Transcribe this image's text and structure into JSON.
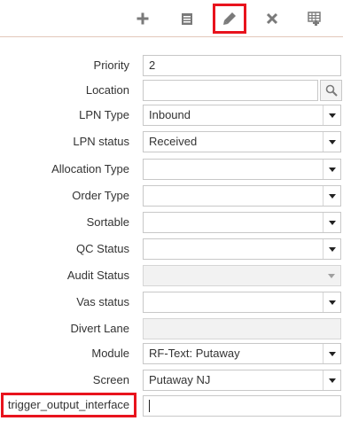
{
  "toolbar": {
    "buttons": [
      {
        "icon": "plus-icon",
        "tooltip": ""
      },
      {
        "icon": "details-icon",
        "tooltip": ""
      },
      {
        "icon": "pencil-icon",
        "tooltip": "",
        "highlighted": true
      },
      {
        "icon": "close-icon",
        "tooltip": ""
      },
      {
        "icon": "grid-settings-icon",
        "tooltip": ""
      }
    ]
  },
  "form": {
    "priority": {
      "label": "Priority",
      "value": "2"
    },
    "location": {
      "label": "Location",
      "value": ""
    },
    "lpn_type": {
      "label": "LPN Type",
      "value": "Inbound"
    },
    "lpn_status": {
      "label": "LPN status",
      "value": "Received"
    },
    "allocation_type": {
      "label": "Allocation Type",
      "value": ""
    },
    "order_type": {
      "label": "Order Type",
      "value": ""
    },
    "sortable": {
      "label": "Sortable",
      "value": ""
    },
    "qc_status": {
      "label": "QC Status",
      "value": ""
    },
    "audit_status": {
      "label": "Audit Status",
      "value": ""
    },
    "vas_status": {
      "label": "Vas status",
      "value": ""
    },
    "divert_lane": {
      "label": "Divert Lane",
      "value": ""
    },
    "module": {
      "label": "Module",
      "value": "RF-Text: Putaway"
    },
    "screen": {
      "label": "Screen",
      "value": "Putaway NJ"
    },
    "trigger_output_interface": {
      "label": "trigger_output_interface",
      "value": ""
    }
  },
  "colors": {
    "highlight": "#e8131d",
    "icon": "#7a7a7a",
    "toolbar_divider": "#e3c7ba"
  }
}
